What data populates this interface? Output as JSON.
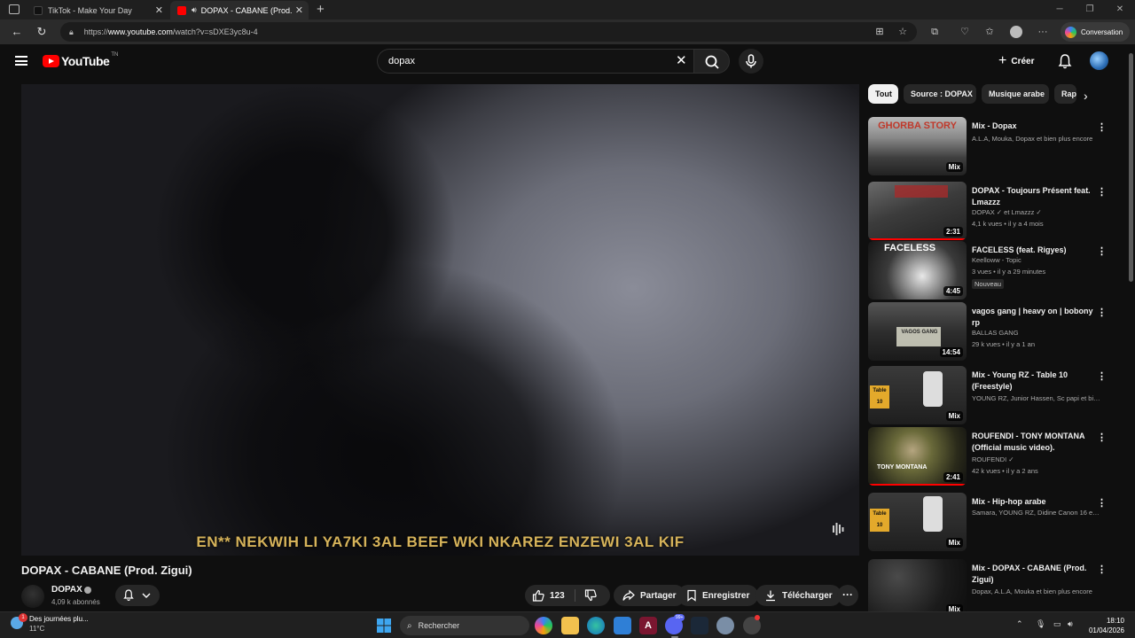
{
  "browser": {
    "tabs": [
      {
        "title": "TikTok - Make Your Day",
        "close": "✕"
      },
      {
        "title": "DOPAX - CABANE (Prod. Zig",
        "close": "✕"
      }
    ],
    "new_tab": "+",
    "url_scheme": "https://",
    "url_host": "www.youtube.com",
    "url_path": "/watch?v=sDXE3yc8u-4",
    "conversation_label": "Conversation"
  },
  "header": {
    "logo": "YouTube",
    "logo_suffix": "TN",
    "search_value": "dopax",
    "create_label": "Créer"
  },
  "player": {
    "subtitle": "EN** NEKWIH LI YA7KI 3AL BEEF WKI NKAREZ ENZEWI 3AL KIF"
  },
  "video": {
    "title": "DOPAX - CABANE (Prod. Zigui)",
    "channel": "DOPAX",
    "subscribers": "4,09 k abonnés",
    "likes": "123",
    "share_label": "Partager",
    "save_label": "Enregistrer",
    "download_label": "Télécharger",
    "more_label": "···"
  },
  "chips": [
    "Tout",
    "Source : DOPAX",
    "Musique arabe",
    "Rap"
  ],
  "recommendations": [
    {
      "title": "Mix - Dopax",
      "line1": "A.L.A, Mouka, Dopax et bien plus encore",
      "line2": "",
      "badge": "",
      "duration": "Mix",
      "progress": false,
      "thumb_text": "GHORBA STORY"
    },
    {
      "title": "DOPAX - Toujours Présent feat. Lmazzz",
      "line1": "DOPAX ✓ et Lmazzz ✓",
      "line2": "4,1 k vues • il y a 4 mois",
      "badge": "",
      "duration": "2:31",
      "progress": true,
      "thumb_text": ""
    },
    {
      "title": "FACELESS (feat. Rigyes)",
      "line1": "Keelloww - Topic",
      "line2": "3 vues • il y a 29 minutes",
      "badge": "Nouveau",
      "duration": "4:45",
      "progress": false,
      "thumb_text": "FACELESS"
    },
    {
      "title": "vagos gang | heavy on    | bobony rp",
      "line1": "BALLAS GANG",
      "line2": "29 k vues • il y a 1 an",
      "badge": "",
      "duration": "14:54",
      "progress": false,
      "thumb_text": "VAGOS GANG"
    },
    {
      "title": "Mix - Young RZ - Table 10 (Freestyle)",
      "line1": "YOUNG RZ, Junior Hassen, Sc papi et bie...",
      "line2": "",
      "badge": "",
      "duration": "Mix",
      "progress": false,
      "thumb_text": "Table 10"
    },
    {
      "title": "ROUFENDI  - TONY MONTANA (Official music video).",
      "line1": "ROUFENDI ✓",
      "line2": "42 k vues • il y a 2 ans",
      "badge": "",
      "duration": "2:41",
      "progress": true,
      "thumb_text": "TONY MONTANA"
    },
    {
      "title": "Mix - Hip-hop arabe",
      "line1": "Samara, YOUNG RZ, Didine Canon 16 et ...",
      "line2": "",
      "badge": "",
      "duration": "Mix",
      "progress": false,
      "thumb_text": "Table 10"
    },
    {
      "title": "Mix - DOPAX - CABANE (Prod. Zigui)",
      "line1": "Dopax, A.L.A, Mouka et bien plus encore",
      "line2": "",
      "badge": "",
      "duration": "Mix",
      "progress": false,
      "thumb_text": ""
    }
  ],
  "taskbar": {
    "weather_title": "Des journées plu...",
    "weather_temp": "11°C",
    "weather_badge": "1",
    "search_placeholder": "Rechercher",
    "discord_badge": "99+",
    "time": "18:10",
    "date": "01/04/2026"
  }
}
